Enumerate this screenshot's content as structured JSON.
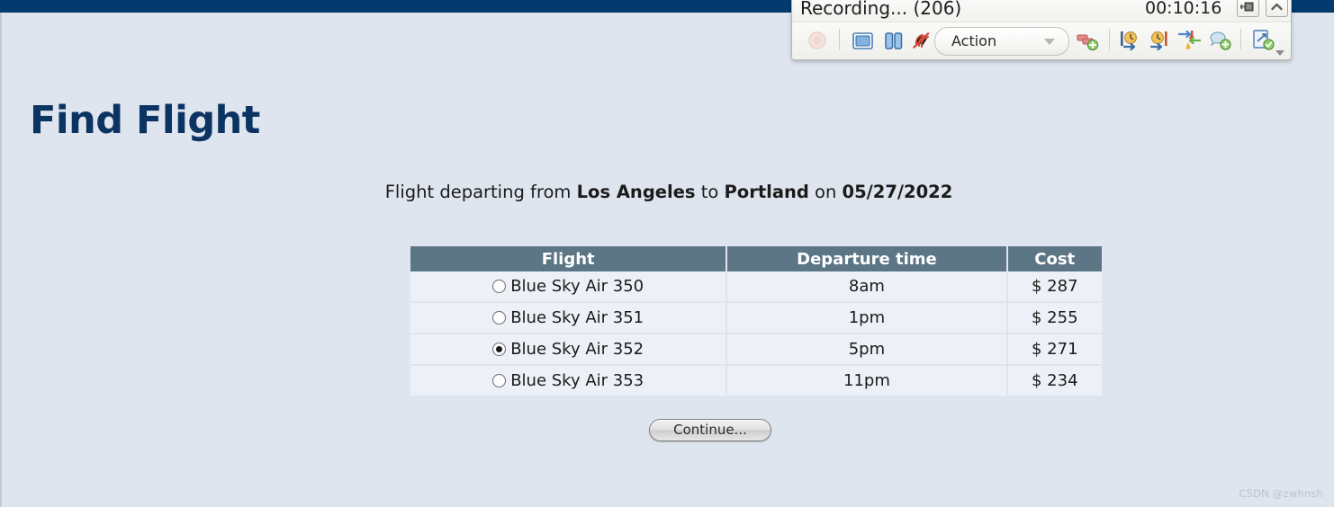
{
  "page": {
    "title": "Find Flight",
    "summary": {
      "prefix": "Flight departing from ",
      "origin": "Los Angeles",
      "mid": " to ",
      "destination": "Portland",
      "on": " on ",
      "date": "05/27/2022"
    },
    "continue_label": "Continue...",
    "watermark": "CSDN @zwhnsh",
    "accent_color": "#0c3462",
    "header_bg": "#5c7686",
    "row_bg": "#edf0f6",
    "page_bg": "#dfe5ef",
    "top_bar_color": "#023a6d"
  },
  "table": {
    "columns": [
      "Flight",
      "Departure time",
      "Cost"
    ],
    "rows": [
      {
        "flight": "Blue Sky Air 350",
        "time": "8am",
        "cost": "$ 287",
        "selected": false
      },
      {
        "flight": "Blue Sky Air 351",
        "time": "1pm",
        "cost": "$ 255",
        "selected": false
      },
      {
        "flight": "Blue Sky Air 352",
        "time": "5pm",
        "cost": "$ 271",
        "selected": true
      },
      {
        "flight": "Blue Sky Air 353",
        "time": "11pm",
        "cost": "$ 234",
        "selected": false
      }
    ]
  },
  "recorder": {
    "title": "Recording... (206)",
    "timer": "00:10:16",
    "action_label": "Action",
    "window_buttons": [
      "dock-icon",
      "chevron-up-icon"
    ],
    "toolbar_icons": [
      "record-icon",
      "stop-icon",
      "pause-icon",
      "cancel-recording-icon",
      "add-step-icon",
      "add-checkpoint-before-icon",
      "add-checkpoint-after-icon",
      "add-output-value-icon",
      "add-comment-icon",
      "add-verification-icon"
    ],
    "overflow_icon": "chevron-down-icon"
  }
}
